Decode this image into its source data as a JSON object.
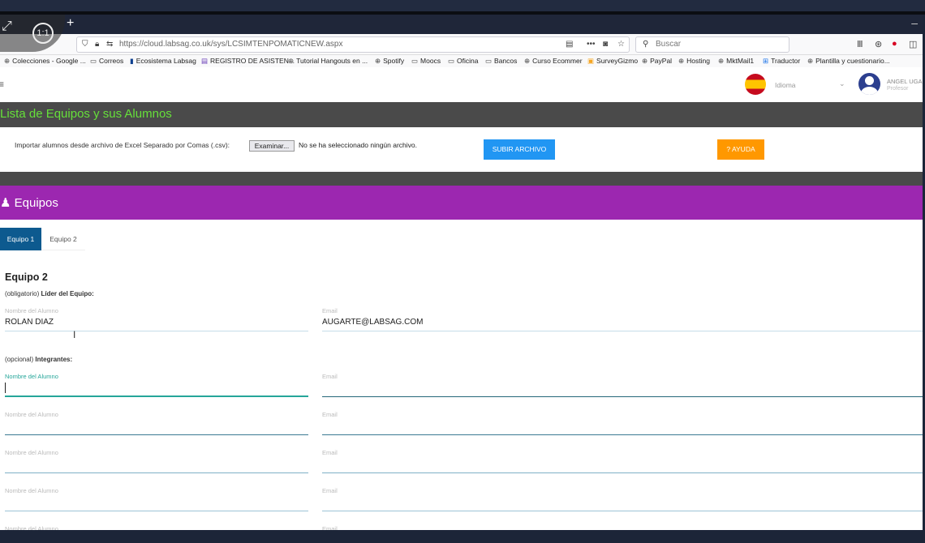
{
  "browser": {
    "url": "https://cloud.labsag.co.uk/sys/LCSIMTENPOMATICNEW.aspx",
    "search_placeholder": "Buscar",
    "new_tab": "+",
    "minimize": "–",
    "zoom_label": "1:1",
    "bookmarks": [
      {
        "label": "Colecciones - Google ...",
        "icon": "globe-icon"
      },
      {
        "label": "Correos",
        "icon": "folder-icon"
      },
      {
        "label": "Ecosistema Labsag",
        "icon": "labsag-icon"
      },
      {
        "label": "REGISTRO DE ASISTEN...",
        "icon": "form-icon"
      },
      {
        "label": "Tutorial Hangouts en ...",
        "icon": "globe-icon"
      },
      {
        "label": "Spotify",
        "icon": "globe-icon"
      },
      {
        "label": "Moocs",
        "icon": "folder-icon"
      },
      {
        "label": "Oficina",
        "icon": "folder-icon"
      },
      {
        "label": "Bancos",
        "icon": "folder-icon"
      },
      {
        "label": "Curso Ecommer",
        "icon": "globe-icon"
      },
      {
        "label": "SurveyGizmo",
        "icon": "surveygizmo-icon"
      },
      {
        "label": "PayPal",
        "icon": "globe-icon"
      },
      {
        "label": "Hosting",
        "icon": "globe-icon"
      },
      {
        "label": "MktMail1",
        "icon": "globe-icon"
      },
      {
        "label": "Traductor",
        "icon": "translate-icon"
      },
      {
        "label": "Plantilla y cuestionario...",
        "icon": "globe-icon"
      }
    ]
  },
  "header": {
    "language_label": "Idioma",
    "user_name": "ANGEL UGA",
    "user_role": "Profesor"
  },
  "page_title": "Lista de Equipos y sus Alumnos",
  "import": {
    "label": "Importar alumnos desde archivo de Excel Separado por Comas (.csv):",
    "browse_label": "Examinar...",
    "no_file": "No se ha seleccionado ningún archivo.",
    "upload_label": "SUBIR ARCHIVO",
    "help_label": "? AYUDA"
  },
  "teams_section": {
    "title": "Equipos",
    "tabs": [
      "Equipo 1",
      "Equipo 2"
    ],
    "active_tab": "Equipo 1"
  },
  "team": {
    "title": "Equipo 2",
    "leader_prefix": "(obligatorio)",
    "leader_label": "Líder del Equipo:",
    "members_prefix": "(opcional)",
    "members_label": "Integrantes:",
    "name_label": "Nombre del Alumno",
    "email_label": "Email",
    "leader": {
      "name": "ROLAN DIAZ",
      "email": "AUGARTE@LABSAG.COM"
    }
  },
  "colors": {
    "title_band": "#4a4a4a",
    "title_text": "#66e03a",
    "purple_band": "#9c27b0",
    "active_tab": "#0d5a8f",
    "upload_button": "#2196f3",
    "help_button": "#ff9800",
    "focus_line": "#26a69a"
  }
}
